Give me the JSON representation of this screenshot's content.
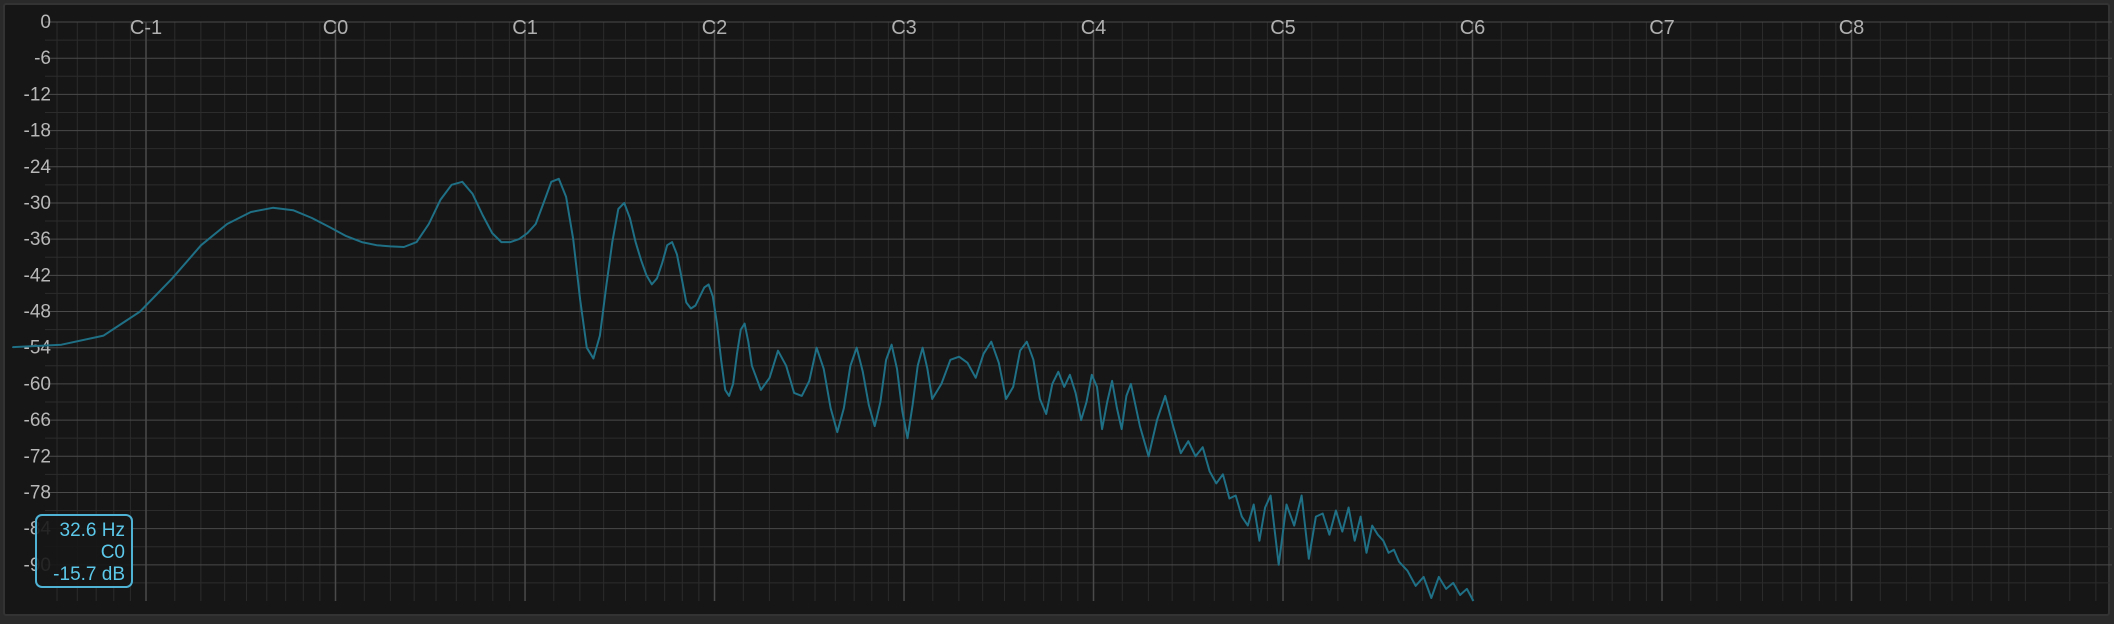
{
  "colors": {
    "background": "#161616",
    "grid_major": "#4a4a4a",
    "grid_minor": "#2c2c2c",
    "curve": "#1f6f85",
    "readout": "#5cc8ea"
  },
  "readout": {
    "frequency": "32.6 Hz",
    "note": "C0",
    "level": "-15.7 dB"
  },
  "chart_data": {
    "type": "line",
    "title": "",
    "xlabel": "",
    "ylabel": "",
    "x_scale": "log (octaves)",
    "x_units": "Hz",
    "y_units": "dB",
    "grid": true,
    "ylim": [
      -96,
      0
    ],
    "yticks": [
      0,
      -6,
      -12,
      -18,
      -24,
      -30,
      -36,
      -42,
      -48,
      -54,
      -60,
      -66,
      -72,
      -78,
      -84,
      -90
    ],
    "ytick_labels": [
      "0",
      "-6",
      "-12",
      "-18",
      "-24",
      "-30",
      "-36",
      "-42",
      "-48",
      "-54",
      "-60",
      "-66",
      "-72",
      "-78",
      "-84",
      "-90"
    ],
    "octave_labels": [
      "C-1",
      "C0",
      "C1",
      "C2",
      "C3",
      "C4",
      "C5",
      "C6",
      "C7",
      "C8"
    ],
    "octave_frequencies": [
      16.35,
      32.7,
      65.41,
      130.81,
      261.63,
      523.25,
      1046.5,
      2093.0,
      4186.0,
      8372.0
    ],
    "series": [
      {
        "frequency_hz": [
          5,
          8,
          10,
          12,
          14,
          16,
          18,
          20,
          22,
          24,
          26,
          28,
          30,
          32,
          34,
          36,
          38,
          40,
          42,
          44,
          46,
          48,
          50,
          52,
          54,
          56,
          58,
          60,
          62,
          64,
          66,
          68,
          70,
          72,
          74,
          76,
          78,
          80,
          82,
          84,
          86,
          88,
          90,
          92,
          94,
          96,
          98,
          100,
          102,
          104,
          106,
          108,
          110,
          112,
          114,
          116,
          118,
          120,
          122,
          124,
          126,
          128,
          130,
          132,
          134,
          136,
          138,
          140,
          142,
          144,
          146,
          148,
          150,
          155,
          160,
          165,
          170,
          175,
          180,
          185,
          190,
          195,
          200,
          205,
          210,
          215,
          220,
          225,
          230,
          235,
          240,
          245,
          250,
          255,
          260,
          265,
          270,
          275,
          280,
          285,
          290,
          300,
          310,
          320,
          330,
          340,
          350,
          360,
          370,
          380,
          390,
          400,
          410,
          420,
          430,
          440,
          450,
          460,
          470,
          480,
          490,
          500,
          510,
          520,
          530,
          540,
          550,
          560,
          570,
          580,
          590,
          600,
          620,
          640,
          660,
          680,
          700,
          720,
          740,
          760,
          780,
          800,
          820,
          840,
          860,
          880,
          900,
          920,
          940,
          960,
          980,
          1000,
          1030,
          1060,
          1090,
          1120,
          1150,
          1180,
          1210,
          1240,
          1270,
          1300,
          1330,
          1360,
          1390,
          1420,
          1450,
          1480,
          1510,
          1540,
          1570,
          1600,
          1650,
          1700,
          1750,
          1800,
          1850,
          1900,
          1950,
          2000,
          2050,
          2100
        ],
        "level_db": [
          -53.8,
          -53.9,
          -53.9,
          -53.5,
          -52.0,
          -48.0,
          -42.5,
          -37.0,
          -33.5,
          -31.5,
          -30.8,
          -31.2,
          -32.5,
          -34.0,
          -35.5,
          -36.5,
          -37.0,
          -37.2,
          -37.3,
          -36.5,
          -33.5,
          -29.5,
          -27.0,
          -26.5,
          -28.5,
          -32.0,
          -35.0,
          -36.5,
          -36.5,
          -36.0,
          -35.0,
          -33.5,
          -30.0,
          -26.5,
          -26.0,
          -29.0,
          -36.0,
          -46.0,
          -54.0,
          -55.8,
          -52.0,
          -44.0,
          -36.5,
          -31.0,
          -30.0,
          -32.5,
          -36.5,
          -39.5,
          -42.0,
          -43.5,
          -42.5,
          -40.0,
          -37.0,
          -36.5,
          -38.5,
          -42.5,
          -46.5,
          -47.5,
          -47.0,
          -45.5,
          -44.0,
          -43.5,
          -45.5,
          -50.0,
          -56.0,
          -61.0,
          -62.0,
          -60.0,
          -55.0,
          -51.0,
          -50.0,
          -53.0,
          -57.0,
          -61.0,
          -59.0,
          -54.5,
          -57.0,
          -61.5,
          -62.0,
          -59.5,
          -54.0,
          -57.5,
          -64.0,
          -68.0,
          -64.0,
          -57.0,
          -54.0,
          -58.0,
          -63.5,
          -67.0,
          -63.0,
          -56.0,
          -53.5,
          -57.5,
          -64.5,
          -69.0,
          -63.5,
          -57.0,
          -54.0,
          -57.5,
          -62.5,
          -60.0,
          -56.0,
          -55.5,
          -56.5,
          -59.0,
          -55.0,
          -53.0,
          -56.5,
          -62.5,
          -60.5,
          -54.5,
          -53.0,
          -56.0,
          -62.5,
          -65.0,
          -60.0,
          -58.0,
          -60.5,
          -58.5,
          -61.5,
          -66.0,
          -63.0,
          -58.5,
          -60.5,
          -67.5,
          -63.0,
          -59.5,
          -64.0,
          -67.5,
          -62.0,
          -60.0,
          -67.0,
          -72.0,
          -66.0,
          -62.0,
          -67.0,
          -71.5,
          -69.5,
          -72.0,
          -70.5,
          -74.5,
          -76.5,
          -75.0,
          -79.0,
          -78.5,
          -82.0,
          -83.5,
          -80.0,
          -86.0,
          -80.5,
          -78.5,
          -90.0,
          -80.0,
          -83.5,
          -78.5,
          -89.0,
          -82.0,
          -81.5,
          -85.0,
          -81.0,
          -84.5,
          -80.5,
          -86.0,
          -82.0,
          -88.0,
          -83.5,
          -85.0,
          -86.0,
          -88.0,
          -87.5,
          -89.5,
          -91.0,
          -93.5,
          -92.0,
          -95.5,
          -92.0,
          -94.0,
          -93.0,
          -95.0,
          -94.0,
          -96.0
        ]
      }
    ]
  }
}
